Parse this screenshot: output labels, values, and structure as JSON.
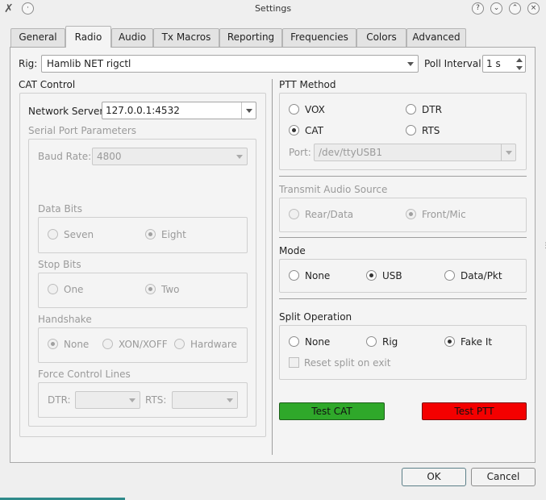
{
  "window": {
    "title": "Settings"
  },
  "tabs": [
    "General",
    "Radio",
    "Audio",
    "Tx Macros",
    "Reporting",
    "Frequencies",
    "Colors",
    "Advanced"
  ],
  "rig": {
    "label": "Rig:",
    "value": "Hamlib NET rigctl",
    "poll_label": "Poll Interval:",
    "poll_value": "1 s"
  },
  "cat": {
    "title": "CAT Control",
    "network_label": "Network Server:",
    "network_value": "127.0.0.1:4532",
    "serial_title": "Serial Port Parameters",
    "baud_label": "Baud Rate:",
    "baud_value": "4800",
    "data_bits_title": "Data Bits",
    "data_bits": [
      "Seven",
      "Eight"
    ],
    "stop_bits_title": "Stop Bits",
    "stop_bits": [
      "One",
      "Two"
    ],
    "handshake_title": "Handshake",
    "handshake": [
      "None",
      "XON/XOFF",
      "Hardware"
    ],
    "force_title": "Force Control Lines",
    "dtr_label": "DTR:",
    "rts_label": "RTS:"
  },
  "ptt": {
    "title": "PTT Method",
    "options": [
      "VOX",
      "DTR",
      "CAT",
      "RTS"
    ],
    "port_label": "Port:",
    "port_value": "/dev/ttyUSB1"
  },
  "audio_source": {
    "title": "Transmit Audio Source",
    "options": [
      "Rear/Data",
      "Front/Mic"
    ]
  },
  "mode": {
    "title": "Mode",
    "options": [
      "None",
      "USB",
      "Data/Pkt"
    ]
  },
  "split": {
    "title": "Split Operation",
    "options": [
      "None",
      "Rig",
      "Fake It"
    ],
    "reset_label": "Reset split on exit"
  },
  "buttons": {
    "test_cat": "Test CAT",
    "test_ptt": "Test PTT",
    "ok": "OK",
    "cancel": "Cancel"
  },
  "colors": {
    "test_cat_bg": "#2fa82a",
    "test_ptt_bg": "#f40000"
  }
}
